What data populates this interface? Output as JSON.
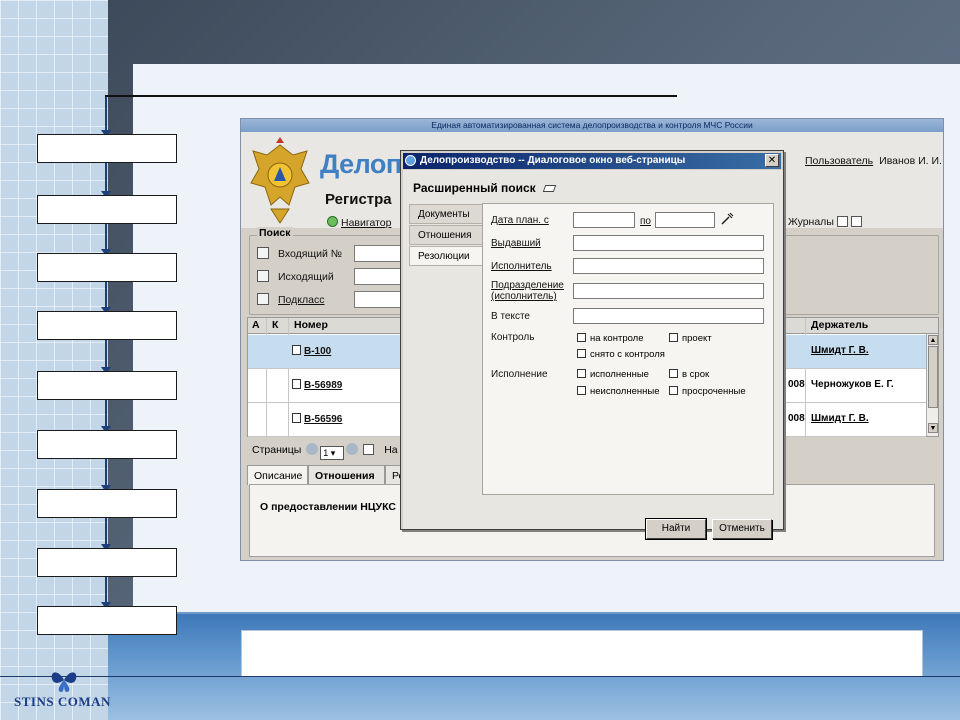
{
  "app": {
    "top_banner": "Единая автоматизированная система делопроизводства и контроля МЧС России",
    "name": "Делопроизводство",
    "user_label": "Пользователь",
    "user_name": "Иванов И. И.",
    "section_title": "Регистра",
    "navigator": "Навигатор",
    "journals": "Журналы"
  },
  "search": {
    "legend": "Поиск",
    "rows": [
      {
        "label": "Входящий №",
        "icon": "inbox-icon"
      },
      {
        "label": "Исходящий",
        "icon": "outbox-icon"
      },
      {
        "label": "Подкласс",
        "icon": "subclass-icon"
      }
    ]
  },
  "grid": {
    "columns": {
      "a": "А",
      "k": "К",
      "number": "Номер",
      "holder": "Держатель"
    },
    "rows": [
      {
        "number": "В-100",
        "date_frag": "",
        "holder": "Шмидт Г. В.",
        "selected": true
      },
      {
        "number": "В-56989",
        "date_frag": "008",
        "holder": "Черножуков Е. Г.",
        "selected": false
      },
      {
        "number": "В-56596",
        "date_frag": "008",
        "holder": "Шмидт Г. В.",
        "selected": false
      }
    ]
  },
  "pager": {
    "label": "Страницы",
    "page": "1",
    "next_label": "На"
  },
  "tabs": {
    "items": [
      "Описание",
      "Отношения",
      "Ре"
    ],
    "panel_text": "О предоставлении НЦУКС"
  },
  "dialog": {
    "title": "Делопроизводство -- Диалоговое окно веб-страницы",
    "heading": "Расширенный поиск",
    "side_tabs": [
      "Документы",
      "Отношения",
      "Резолюции"
    ],
    "fields": {
      "date_from": "Дата план. с",
      "date_to": "по",
      "issuer": "Выдавший",
      "executor": "Исполнитель",
      "division_1": "Подразделение",
      "division_2": "(исполнитель)",
      "in_text": "В тексте",
      "control": "Контроль",
      "execution": "Исполнение"
    },
    "checkboxes": {
      "on_control": "на контроле",
      "project": "проект",
      "off_control": "снято с контроля",
      "executed": "исполненные",
      "in_time": "в срок",
      "not_executed": "неисполненные",
      "overdue": "просроченные"
    },
    "buttons": {
      "find": "Найти",
      "cancel": "Отменить"
    }
  },
  "logo": {
    "text": "STINS COMAN"
  },
  "colors": {
    "app_name": "#3f7fc4",
    "title_bar_start": "#0a246a",
    "title_bar_end": "#3a6ea5",
    "selected_row": "#c6dcef",
    "logo": "#1b3c86"
  }
}
